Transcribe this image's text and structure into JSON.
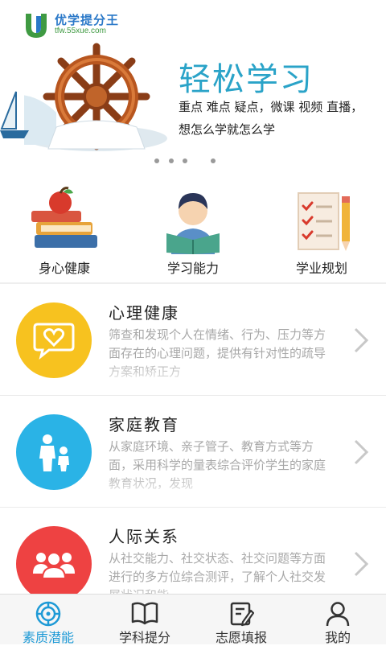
{
  "banner": {
    "logo_name": "优学提分王",
    "logo_url": "tfw.55xue.com",
    "title": "轻松学习",
    "line1": "重点 难点 疑点，微课 视频 直播，",
    "line2": "想怎么学就怎么学",
    "page_count": 4,
    "active_page": 4
  },
  "categories": [
    {
      "label": "身心健康",
      "icon": "books-apple-icon"
    },
    {
      "label": "学习能力",
      "icon": "student-reading-icon"
    },
    {
      "label": "学业规划",
      "icon": "checklist-pencil-icon"
    }
  ],
  "items": [
    {
      "title": "心理健康",
      "desc": "筛查和发现个人在情绪、行为、压力等方面存在的心理问题，提供有针对性的疏导方案和矫正方",
      "color": "#f7c21f",
      "icon": "heart-chat-icon"
    },
    {
      "title": "家庭教育",
      "desc": "从家庭环境、亲子管子、教育方式等方面，采用科学的量表综合评价学生的家庭教育状况，发现",
      "color": "#2ab3e6",
      "icon": "parent-child-icon"
    },
    {
      "title": "人际关系",
      "desc": "从社交能力、社交状态、社交问题等方面进行的多方位综合测评，了解个人社交发展状况和能",
      "color": "#ee4242",
      "icon": "people-group-icon"
    }
  ],
  "tabs": [
    {
      "label": "素质潜能",
      "icon": "compass-icon",
      "active": true
    },
    {
      "label": "学科提分",
      "icon": "open-book-icon",
      "active": false
    },
    {
      "label": "志愿填报",
      "icon": "edit-note-icon",
      "active": false
    },
    {
      "label": "我的",
      "icon": "user-icon",
      "active": false
    }
  ],
  "colors": {
    "accent": "#1e9ad6",
    "banner_title": "#2aa3c8"
  }
}
